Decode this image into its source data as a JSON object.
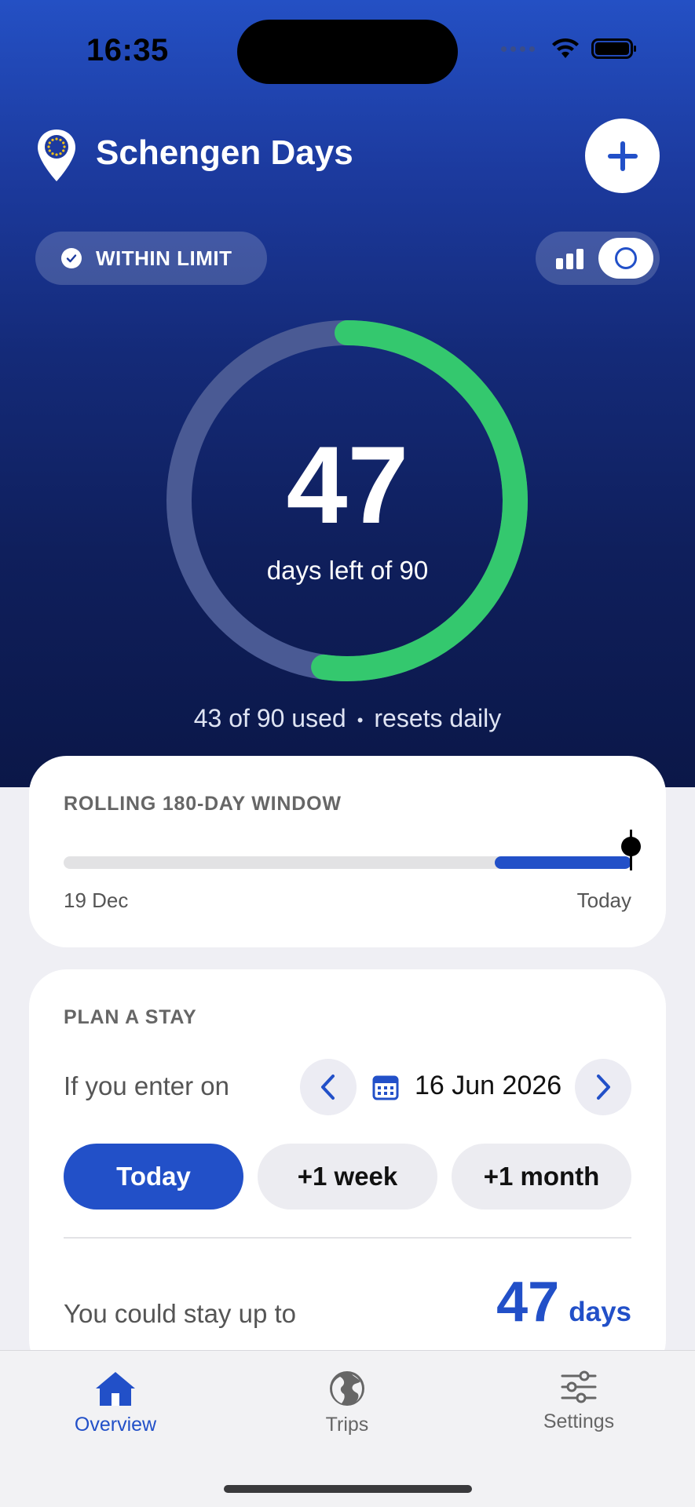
{
  "status_bar": {
    "time": "16:35"
  },
  "header": {
    "title": "Schengen Days",
    "add_icon": "plus-icon",
    "logo_icon": "eu-location-pin-icon"
  },
  "status_pill": {
    "label": "WITHIN LIMIT",
    "icon": "check-circle-icon"
  },
  "view_toggle": {
    "left_icon": "bar-chart-icon",
    "right_icon": "ring-icon",
    "selected": "ring"
  },
  "summary": {
    "days_left": "47",
    "caption": "days left of 90",
    "used_text": "43 of 90 used",
    "separator": "•",
    "reset_text": "resets daily",
    "days_used": 43,
    "days_total": 90
  },
  "window_card": {
    "heading": "ROLLING 180-DAY WINDOW",
    "start_label": "19 Dec",
    "end_label": "Today",
    "used_fraction": 0.24
  },
  "plan_card": {
    "heading": "PLAN A STAY",
    "enter_label": "If you enter on",
    "date": "16 Jun 2026",
    "chips": [
      {
        "label": "Today",
        "active": true
      },
      {
        "label": "+1 week",
        "active": false
      },
      {
        "label": "+1 month",
        "active": false
      }
    ],
    "stay_label": "You could stay up to",
    "stay_value": "47",
    "stay_unit": "days"
  },
  "tabs": [
    {
      "label": "Overview",
      "icon": "house-icon",
      "active": true
    },
    {
      "label": "Trips",
      "icon": "globe-icon",
      "active": false
    },
    {
      "label": "Settings",
      "icon": "sliders-icon",
      "active": false
    }
  ],
  "colors": {
    "accent": "#2250c8",
    "ring_progress": "#34c86e",
    "ring_track": "#4a5a94"
  }
}
